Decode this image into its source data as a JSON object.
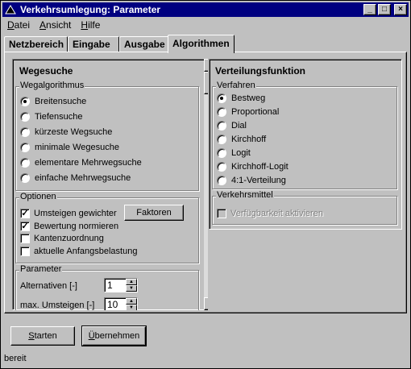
{
  "window": {
    "title": "Verkehrsumlegung: Parameter"
  },
  "titlebar_buttons": {
    "minimize": "_",
    "maximize": "□",
    "close": "×"
  },
  "menu": [
    {
      "accel": "D",
      "rest": "atei"
    },
    {
      "accel": "A",
      "rest": "nsicht"
    },
    {
      "accel": "H",
      "rest": "ilfe"
    }
  ],
  "tabs": [
    {
      "label": "Netzbereich"
    },
    {
      "label": "Eingabe"
    },
    {
      "label": "Ausgabe"
    },
    {
      "label": "Algorithmen",
      "active": true
    }
  ],
  "wegesuche": {
    "title": "Wegesuche",
    "algorithmus": {
      "label": "Wegalgorithmus",
      "options": [
        "Breitensuche",
        "Tiefensuche",
        "kürzeste Wegsuche",
        "minimale Wegesuche",
        "elementare Mehrwegsuche",
        "einfache Mehrwegsuche"
      ],
      "selected": 0
    },
    "optionen": {
      "label": "Optionen",
      "items": [
        {
          "label": "Umsteigen gewichter",
          "checked": true
        },
        {
          "label": "Bewertung normieren",
          "checked": true
        },
        {
          "label": "Kantenzuordnung",
          "checked": false
        },
        {
          "label": "aktuelle Anfangsbelastung",
          "checked": false
        }
      ],
      "faktoren_button": "Faktoren"
    },
    "parameter": {
      "label": "Parameter",
      "fields": [
        {
          "label": "Alternativen [-]",
          "value": "1"
        },
        {
          "label": "max. Umsteigen [-]",
          "value": "10"
        }
      ]
    }
  },
  "verteilung": {
    "title": "Verteilungsfunktion",
    "verfahren": {
      "label": "Verfahren",
      "options": [
        "Bestweg",
        "Proportional",
        "Dial",
        "Kirchhoff",
        "Logit",
        "Kirchhoff-Logit",
        "4:1-Verteilung"
      ],
      "selected": 0
    },
    "verkehrsmittel": {
      "label": "Verkehrsmittel",
      "checkbox_label": "Verfügbarkeit aktivieren",
      "checked": false,
      "enabled": false
    }
  },
  "buttons": {
    "starten": {
      "pre": "",
      "accel": "S",
      "rest": "tarten"
    },
    "uebernehmen": {
      "pre": "",
      "accel": "Ü",
      "rest": "bernehmen"
    }
  },
  "status": {
    "text": "bereit"
  }
}
